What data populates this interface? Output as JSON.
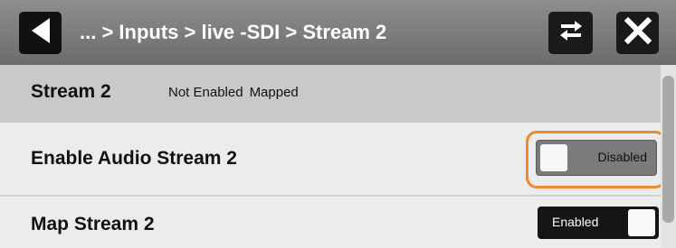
{
  "header": {
    "breadcrumb": "... > Inputs > live -SDI > Stream 2"
  },
  "status": {
    "title": "Stream 2",
    "state1": "Not Enabled",
    "state2": "Mapped"
  },
  "settings": [
    {
      "label": "Enable Audio Stream 2",
      "toggle_text": "Disabled",
      "value": false
    },
    {
      "label": "Map Stream 2",
      "toggle_text": "Enabled",
      "value": true
    }
  ],
  "colors": {
    "highlight": "#ee8a2b",
    "header": "#7a7a7a",
    "status_row": "#c9c9c9"
  },
  "icons": {
    "back": "back-triangle-icon",
    "swap": "swap-arrows-icon",
    "close": "close-x-icon"
  }
}
